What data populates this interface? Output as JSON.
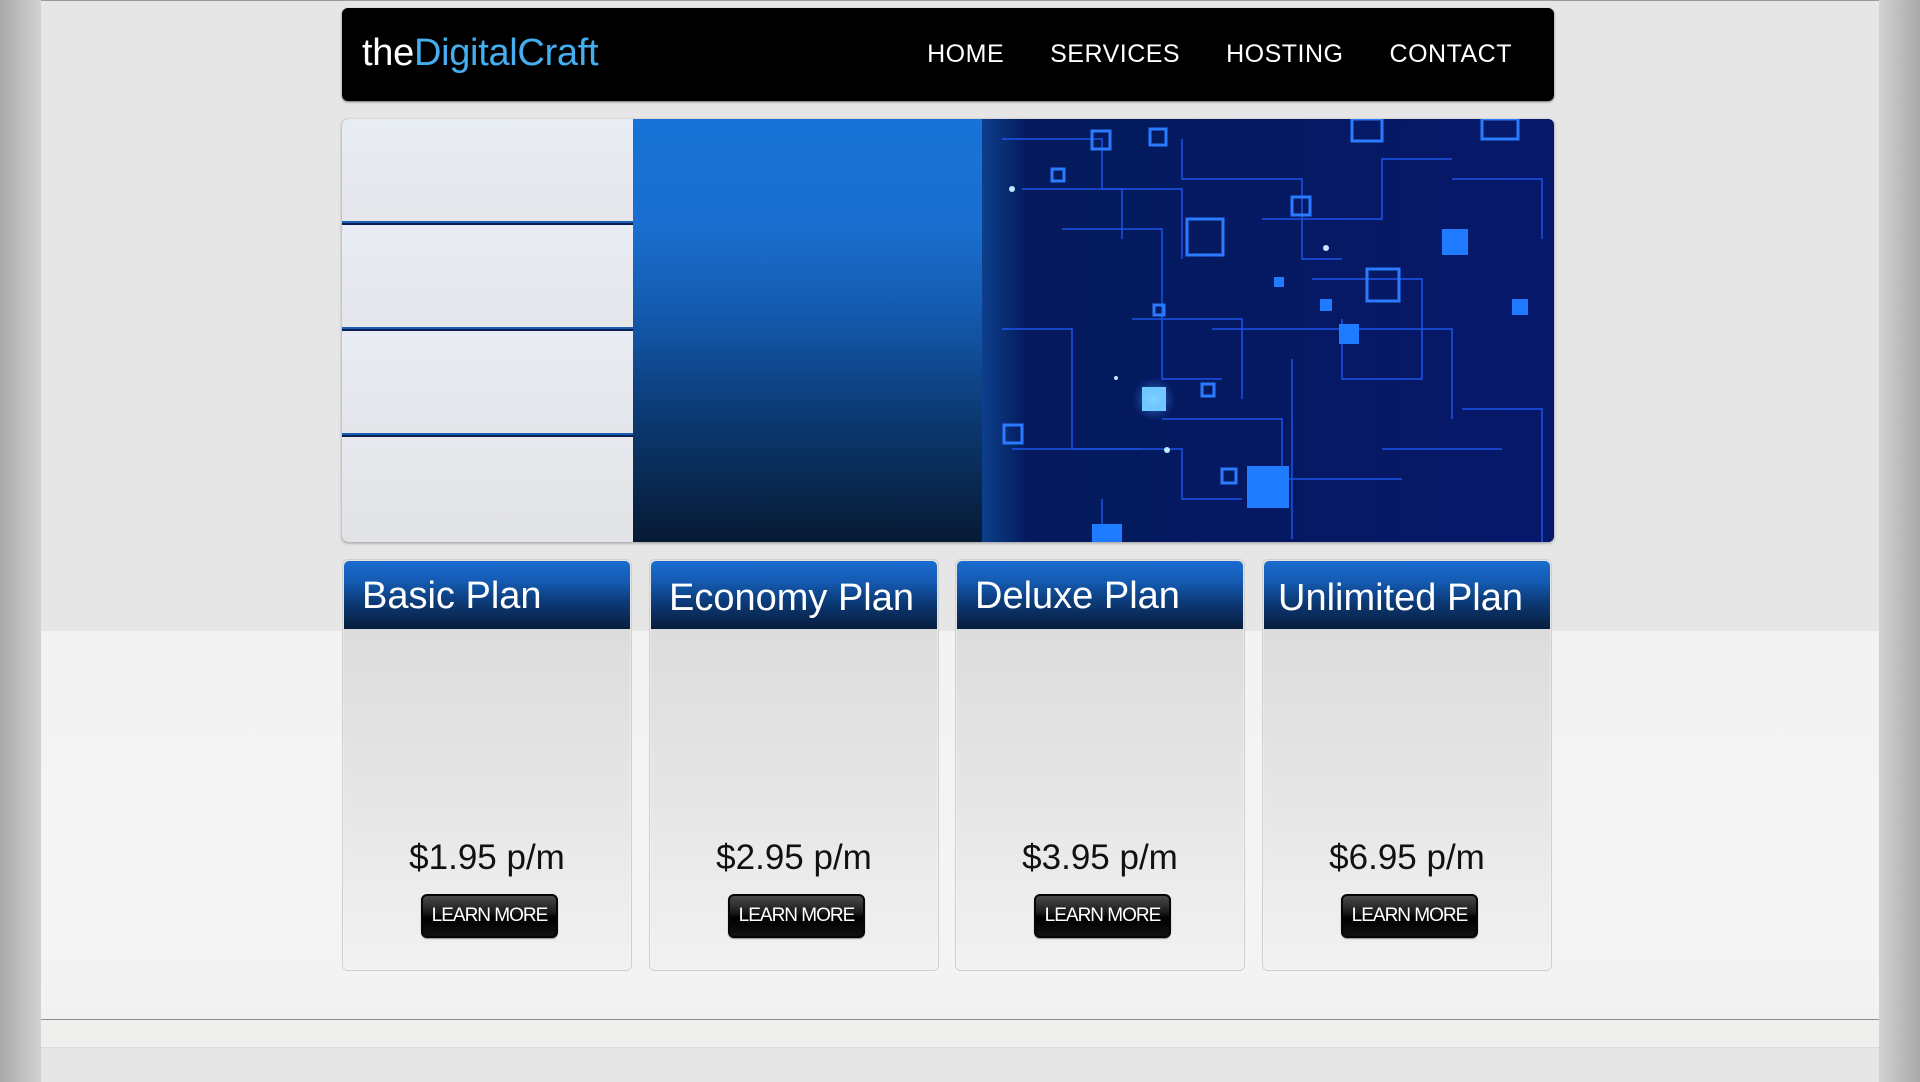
{
  "header": {
    "logo_part1": "the",
    "logo_part2": "DigitalCraft",
    "nav": [
      {
        "label": "HOME"
      },
      {
        "label": "SERVICES"
      },
      {
        "label": "HOSTING"
      },
      {
        "label": "CONTACT"
      }
    ]
  },
  "plans": [
    {
      "title": "Basic Plan",
      "price": "$1.95 p/m",
      "button": "LEARN MORE"
    },
    {
      "title": "Economy Plan",
      "price": "$2.95 p/m",
      "button": "LEARN MORE"
    },
    {
      "title": "Deluxe Plan",
      "price": "$3.95 p/m",
      "button": "LEARN MORE"
    },
    {
      "title": "Unlimited Plan",
      "price": "$6.95 p/m",
      "button": "LEARN MORE"
    }
  ],
  "colors": {
    "header_bg": "#000000",
    "logo_accent": "#45aef1",
    "plan_header_blue": "#1a6cd1",
    "button_bg": "#000000"
  }
}
